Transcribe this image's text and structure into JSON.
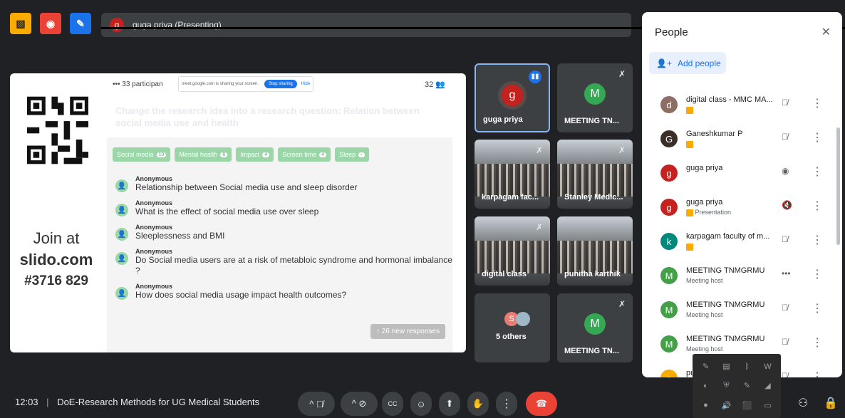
{
  "top": {
    "badges": [
      {
        "name": "present-icon",
        "glyph": "▧",
        "color": "#f9ab00"
      },
      {
        "name": "record-icon",
        "glyph": "◉",
        "color": "#ea4335"
      },
      {
        "name": "whiteboard-icon",
        "glyph": "✎",
        "color": "#1a73e8"
      }
    ],
    "presenter_initial": "g",
    "presenting_label": "guga priya (Presenting)"
  },
  "slide": {
    "join_line1": "Join at",
    "join_line2": "slido.com",
    "join_line3": "#3716 829",
    "participants": "••• 33 participan",
    "share_notice": "meet.google.com is sharing your screen.",
    "stop_sharing": "Stop sharing",
    "hide": "Hide",
    "count": "32 👥",
    "question": "Change the research idea into a research question: Relation between social media use and health",
    "tags": [
      {
        "label": "Social media",
        "n": "10"
      },
      {
        "label": "Mental health",
        "n": "6"
      },
      {
        "label": "Impact",
        "n": "4"
      },
      {
        "label": "Screen time",
        "n": "4"
      },
      {
        "label": "Sleep",
        "n": "›"
      }
    ],
    "answers": [
      {
        "who": "Anonymous",
        "text": "Relationship between Social media use and sleep disorder"
      },
      {
        "who": "Anonymous",
        "text": "What is the effect of social media use over sleep"
      },
      {
        "who": "Anonymous",
        "text": "Sleeplessness and BMI"
      },
      {
        "who": "Anonymous",
        "text": "Do Social media users are at a risk of metabloic syndrome and hormonal imbalance ?"
      },
      {
        "who": "Anonymous",
        "text": "How does social media usage impact health outcomes?"
      }
    ],
    "new_responses": "↑ 26 new responses"
  },
  "tiles": [
    {
      "name": "guga priya",
      "initial": "g",
      "color": "#c5221f"
    },
    {
      "name": "MEETING TN...",
      "initial": "M",
      "color": "#34a853"
    },
    {
      "name": "karpagam fac...",
      "initial": ""
    },
    {
      "name": "Stanley Medic...",
      "initial": ""
    },
    {
      "name": "digital class",
      "initial": ""
    },
    {
      "name": "punitha karthik",
      "initial": ""
    },
    {
      "name": "5 others",
      "initial": "S"
    },
    {
      "name": "MEETING TN...",
      "initial": "M",
      "color": "#34a853"
    }
  ],
  "people": {
    "title": "People",
    "close": "✕",
    "add_people": "Add people",
    "rows": [
      {
        "initial": "d",
        "color": "#8d6e63",
        "name": "digital class - MMC MA...",
        "sub": "",
        "mic": "🎙̸"
      },
      {
        "initial": "G",
        "color": "#3c2f2a",
        "name": "Ganeshkumar P",
        "sub": "",
        "mic": "🎙̸"
      },
      {
        "initial": "g",
        "color": "#c5221f",
        "name": "guga priya",
        "sub": "",
        "mic": "◉"
      },
      {
        "initial": "g",
        "color": "#c5221f",
        "name": "guga priya",
        "sub": "Presentation",
        "mic": "🔇"
      },
      {
        "initial": "k",
        "color": "#00897b",
        "name": "karpagam faculty of m...",
        "sub": "",
        "mic": "🎙̸"
      },
      {
        "initial": "M",
        "color": "#43a047",
        "name": "MEETING TNMGRMU",
        "sub": "Meeting host",
        "mic": "•••"
      },
      {
        "initial": "M",
        "color": "#43a047",
        "name": "MEETING TNMGRMU",
        "sub": "Meeting host",
        "mic": "🎙̸"
      },
      {
        "initial": "M",
        "color": "#43a047",
        "name": "MEETING TNMGRMU",
        "sub": "Meeting host",
        "mic": "🎙̸"
      },
      {
        "initial": "p",
        "color": "#f9ab00",
        "name": "pu",
        "sub": "",
        "mic": "🎙̸"
      }
    ]
  },
  "tray": [
    "✎",
    "▤",
    "ᛒ",
    "W",
    "◐",
    "⛨",
    "✎",
    "◢",
    "●",
    "🔊",
    "⬛",
    "▭"
  ],
  "bottom": {
    "time": "12:03",
    "separator": "|",
    "meeting": "DoE-Research Methods for UG Medical Students",
    "mic_off": "^ 🎙̸",
    "cam_off": "^ ⊘",
    "captions": "CC",
    "emoji": "☺",
    "present": "⬆",
    "raise_hand": "✋",
    "more": "⋮",
    "end_call": "☎",
    "activities": "⚇",
    "host_controls": "🔒"
  }
}
